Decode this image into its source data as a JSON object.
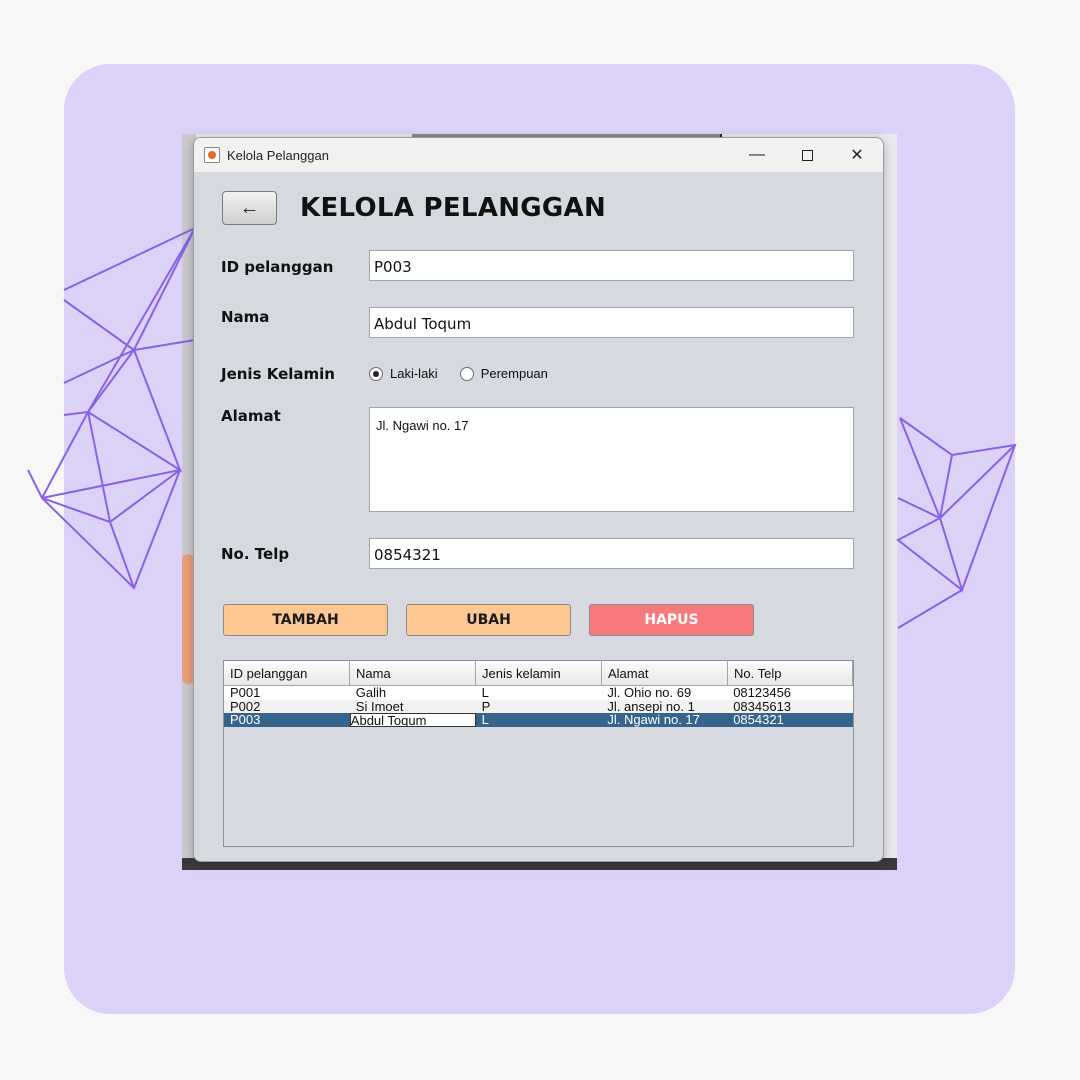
{
  "window": {
    "title": "Kelola Pelanggan",
    "minimize_glyph": "—",
    "close_glyph": "✕"
  },
  "header": {
    "back_glyph": "←",
    "heading": "KELOLA PELANGGAN"
  },
  "form": {
    "id_label": "ID pelanggan",
    "id_value": "P003",
    "nama_label": "Nama",
    "nama_value": "Abdul Toqum",
    "gender_label": "Jenis Kelamin",
    "gender_options": [
      "Laki-laki",
      "Perempuan"
    ],
    "gender_selected": "Laki-laki",
    "alamat_label": "Alamat",
    "alamat_value": "Jl. Ngawi no. 17",
    "telp_label": "No. Telp",
    "telp_value": "0854321"
  },
  "buttons": {
    "tambah": "TAMBAH",
    "ubah": "UBAH",
    "hapus": "HAPUS"
  },
  "table": {
    "columns": [
      "ID pelanggan",
      "Nama",
      "Jenis kelamin",
      "Alamat",
      "No. Telp"
    ],
    "rows": [
      [
        "P001",
        "Galih",
        "L",
        "Jl. Ohio no. 69",
        "08123456"
      ],
      [
        "P002",
        "Si Imoet",
        "P",
        "Jl. ansepi no. 1",
        "08345613"
      ],
      [
        "P003",
        "Abdul Toqum",
        "L",
        "Jl. Ngawi no. 17",
        "0854321"
      ]
    ],
    "selected_row": 2
  },
  "colors": {
    "card": "#dcd2f7",
    "deco_lines": "#8a62e3",
    "button_orange": "#fdc792",
    "button_red": "#f97a7d",
    "selection": "#37648d"
  }
}
